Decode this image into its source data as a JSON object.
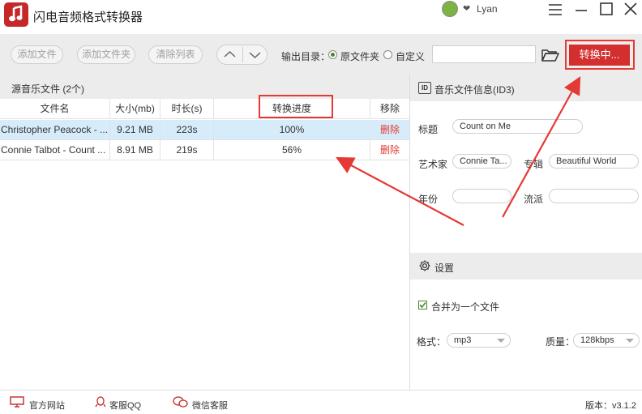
{
  "app": {
    "title": "闪电音频格式转换器"
  },
  "user": {
    "name": "Lyan"
  },
  "toolbar": {
    "add_file": "添加文件",
    "add_folder": "添加文件夹",
    "clear_list": "清除列表",
    "output_dir_label": "输出目录：",
    "option_original": "原文件夹",
    "option_custom": "自定义",
    "output_path": "",
    "convert_button": "转换中..."
  },
  "file_list": {
    "header": "源音乐文件 (2个)",
    "columns": [
      "文件名",
      "大小(mb)",
      "时长(s)",
      "转换进度",
      "移除"
    ],
    "rows": [
      {
        "name": "Christopher Peacock - ...",
        "size": "9.21 MB",
        "duration": "223s",
        "progress": "100%",
        "remove": "删除"
      },
      {
        "name": "Connie Talbot - Count ...",
        "size": "8.91 MB",
        "duration": "219s",
        "progress": "56%",
        "remove": "删除"
      }
    ]
  },
  "id3": {
    "section_title": "音乐文件信息(ID3)",
    "badge": "ID",
    "title_label": "标题",
    "title_value": "Count on Me",
    "artist_label": "艺术家",
    "artist_value": "Connie Ta...",
    "album_label": "专辑",
    "album_value": "Beautiful World",
    "year_label": "年份",
    "year_value": "",
    "genre_label": "流派",
    "genre_value": ""
  },
  "settings": {
    "section_title": "设置",
    "merge_label": "合并为一个文件",
    "merge_checked": true,
    "format_label": "格式：",
    "format_value": "mp3",
    "quality_label": "质量：",
    "quality_value": "128kbps"
  },
  "statusbar": {
    "website": "官方网站",
    "qq_support": "客服QQ",
    "wechat_support": "微信客服",
    "version": "版本：v3.1.2"
  },
  "colors": {
    "accent_red": "#d32f2f",
    "selected_row": "#d7ecfb",
    "panel_gray": "#ececec",
    "check_green": "#4a8a2a"
  }
}
